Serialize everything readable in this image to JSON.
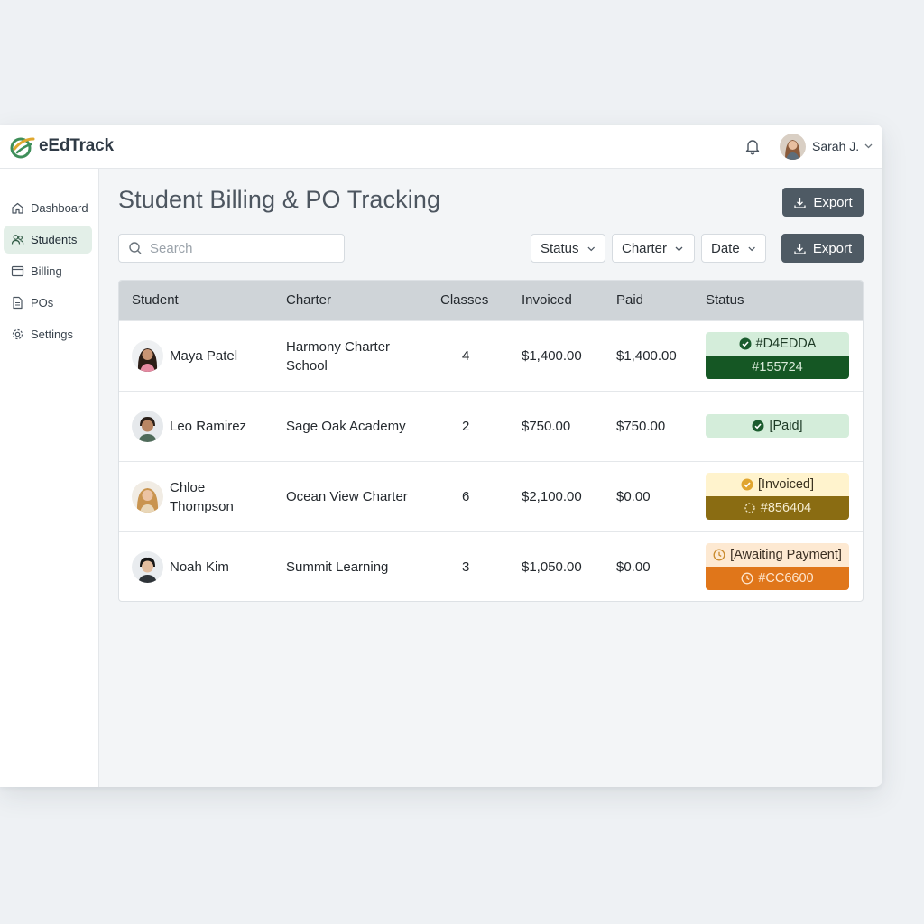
{
  "app": {
    "brand": "eEdTrack"
  },
  "user": {
    "name": "Sarah J."
  },
  "sidebar": {
    "items": [
      {
        "label": "Dashboard",
        "active": false
      },
      {
        "label": "Students",
        "active": true
      },
      {
        "label": "Billing",
        "active": false
      },
      {
        "label": "POs",
        "active": false
      },
      {
        "label": "Settings",
        "active": false
      }
    ]
  },
  "page": {
    "title": "Student Billing & PO Tracking",
    "export_top": "Export",
    "export_filter": "Export"
  },
  "search": {
    "placeholder": "Search",
    "value": ""
  },
  "filters": {
    "status": "Status",
    "charter": "Charter",
    "date": "Date"
  },
  "table": {
    "headers": [
      "Student",
      "Charter",
      "Classes",
      "Invoiced",
      "Paid",
      "Status"
    ],
    "rows": [
      {
        "student": "Maya Patel",
        "charter": "Harmony Charter School",
        "classes": "4",
        "invoiced": "$1,400.00",
        "paid": "$1,400.00",
        "status_top": "#D4EDDA",
        "status_bottom": "#155724"
      },
      {
        "student": "Leo Ramirez",
        "charter": "Sage Oak Academy",
        "classes": "2",
        "invoiced": "$750.00",
        "paid": "$750.00",
        "status_top": "[Paid]"
      },
      {
        "student": "Chloe Thompson",
        "charter": "Ocean View Charter",
        "classes": "6",
        "invoiced": "$2,100.00",
        "paid": "$0.00",
        "status_top": "[Invoiced]",
        "status_bottom": "#856404"
      },
      {
        "student": "Noah Kim",
        "charter": "Summit Learning",
        "classes": "3",
        "invoiced": "$1,050.00",
        "paid": "$0.00",
        "status_top": "[Awaiting Payment]",
        "status_bottom": "#CC6600"
      }
    ]
  },
  "colors": {
    "accent_dark": "#4e5a64",
    "paid_light": "#d4edda",
    "paid_dark": "#155724",
    "invoiced_light": "#fff3cd",
    "invoiced_dark": "#856404",
    "awaiting_light": "#fde9d2",
    "awaiting_dark": "#cc6600"
  },
  "icons": [
    "logo-icon",
    "bell-icon",
    "chevron-down-icon",
    "home-icon",
    "users-icon",
    "billing-icon",
    "document-icon",
    "gear-icon",
    "search-icon",
    "download-icon",
    "check-circle-icon",
    "clock-icon",
    "spinner-icon"
  ]
}
